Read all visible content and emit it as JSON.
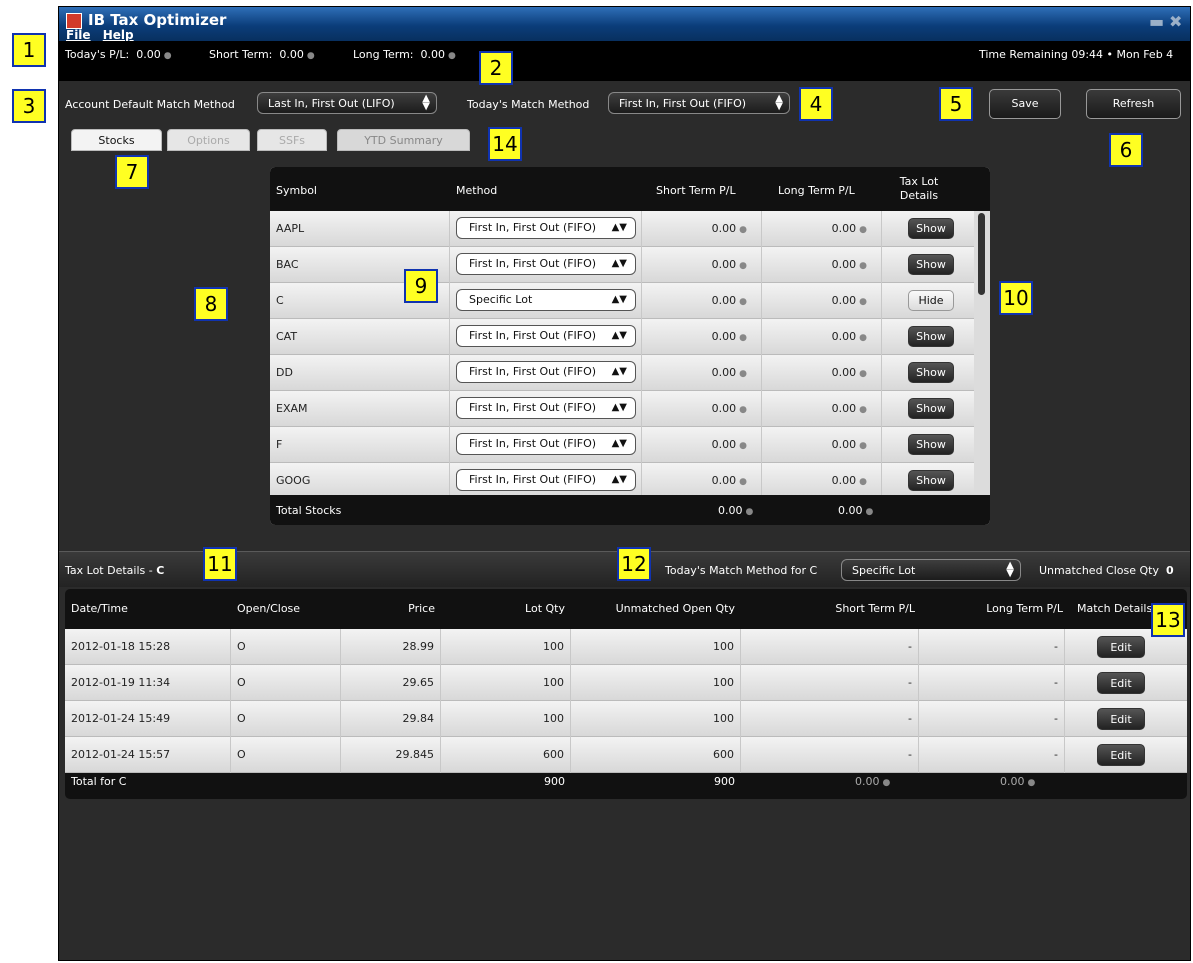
{
  "window": {
    "title": "IB Tax Optimizer",
    "menu": [
      "File",
      "Help"
    ]
  },
  "status": {
    "todays_pl_label": "Today's P/L:",
    "todays_pl": "0.00",
    "short_term_label": "Short Term:",
    "short_term": "0.00",
    "long_term_label": "Long Term:",
    "long_term": "0.00",
    "time_remaining": "Time Remaining 09:44 • Mon Feb 4"
  },
  "toolbar": {
    "account_default_label": "Account Default Match Method",
    "account_default_value": "Last In, First Out (LIFO)",
    "todays_method_label": "Today's Match Method",
    "todays_method_value": "First In, First Out (FIFO)",
    "save_label": "Save",
    "refresh_label": "Refresh"
  },
  "tabs": [
    "Stocks",
    "Options",
    "SSFs",
    "YTD Summary"
  ],
  "stocks": {
    "headers": [
      "Symbol",
      "Method",
      "Short Term P/L",
      "Long Term P/L",
      "Tax Lot Details"
    ],
    "rows": [
      {
        "symbol": "AAPL",
        "method": "First In, First Out (FIFO)",
        "short": "0.00",
        "long": "0.00",
        "action": "Show"
      },
      {
        "symbol": "BAC",
        "method": "First In, First Out (FIFO)",
        "short": "0.00",
        "long": "0.00",
        "action": "Show"
      },
      {
        "symbol": "C",
        "method": "Specific Lot",
        "short": "0.00",
        "long": "0.00",
        "action": "Hide"
      },
      {
        "symbol": "CAT",
        "method": "First In, First Out (FIFO)",
        "short": "0.00",
        "long": "0.00",
        "action": "Show"
      },
      {
        "symbol": "DD",
        "method": "First In, First Out (FIFO)",
        "short": "0.00",
        "long": "0.00",
        "action": "Show"
      },
      {
        "symbol": "EXAM",
        "method": "First In, First Out (FIFO)",
        "short": "0.00",
        "long": "0.00",
        "action": "Show"
      },
      {
        "symbol": "F",
        "method": "First In, First Out (FIFO)",
        "short": "0.00",
        "long": "0.00",
        "action": "Show"
      },
      {
        "symbol": "GOOG",
        "method": "First In, First Out (FIFO)",
        "short": "0.00",
        "long": "0.00",
        "action": "Show"
      }
    ],
    "total_label": "Total Stocks",
    "total_short": "0.00",
    "total_long": "0.00"
  },
  "taxlot": {
    "title": "Tax Lot Details - ",
    "symbol": "C",
    "todays_method_label": "Today's Match Method for C",
    "todays_method_value": "Specific Lot",
    "unmatched_label": "Unmatched Close Qty",
    "unmatched_value": "0",
    "headers": [
      "Date/Time",
      "Open/Close",
      "Price",
      "Lot Qty",
      "Unmatched Open Qty",
      "Short Term P/L",
      "Long Term P/L",
      "Match Details"
    ],
    "rows": [
      {
        "date": "2012-01-18 15:28",
        "oc": "O",
        "price": "28.99",
        "qty": "100",
        "unmatched": "100",
        "short": "-",
        "long": "-",
        "action": "Edit"
      },
      {
        "date": "2012-01-19 11:34",
        "oc": "O",
        "price": "29.65",
        "qty": "100",
        "unmatched": "100",
        "short": "-",
        "long": "-",
        "action": "Edit"
      },
      {
        "date": "2012-01-24 15:49",
        "oc": "O",
        "price": "29.84",
        "qty": "100",
        "unmatched": "100",
        "short": "-",
        "long": "-",
        "action": "Edit"
      },
      {
        "date": "2012-01-24 15:57",
        "oc": "O",
        "price": "29.845",
        "qty": "600",
        "unmatched": "600",
        "short": "-",
        "long": "-",
        "action": "Edit"
      }
    ],
    "total_label": "Total for C",
    "total_qty": "900",
    "total_unmatched": "900",
    "total_short": "0.00",
    "total_long": "0.00"
  },
  "callouts": [
    "1",
    "2",
    "3",
    "4",
    "5",
    "6",
    "7",
    "8",
    "9",
    "10",
    "11",
    "12",
    "13",
    "14"
  ]
}
